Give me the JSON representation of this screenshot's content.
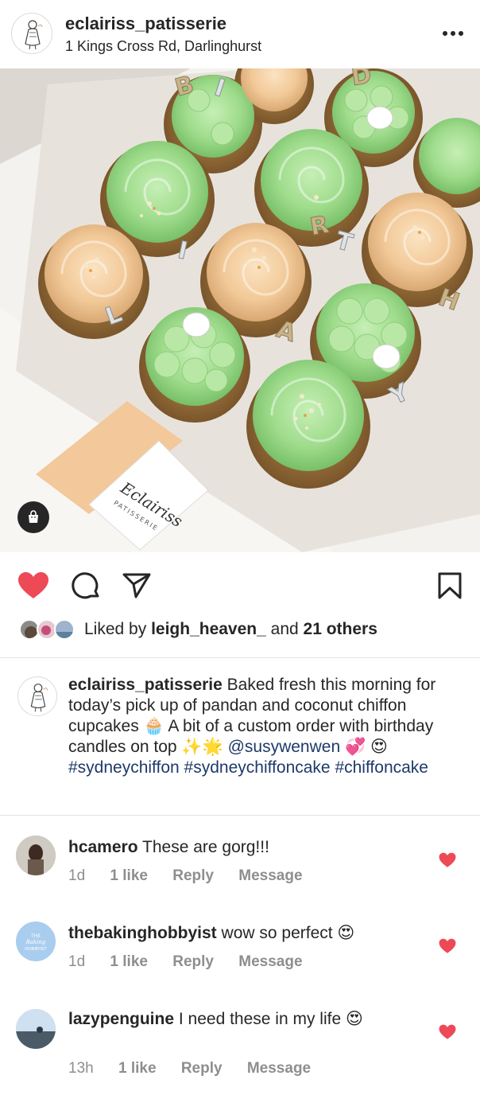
{
  "post": {
    "account": "eclairiss_patisserie",
    "location": "1 Kings Cross Rd, Darlinghurst",
    "liked_by_prefix": "Liked by",
    "liked_by_user": "leigh_heaven_",
    "liked_by_and": "and",
    "liked_by_others": "21 others",
    "is_liked": true
  },
  "photo": {
    "card_brand": "Eclairiss",
    "card_sub": "PATISSERIE",
    "candle_letters": [
      "B",
      "I",
      "R",
      "T",
      "H",
      "D",
      "A",
      "Y"
    ]
  },
  "caption": {
    "user": "eclairiss_patisserie",
    "text": "Baked fresh this morning for today’s pick up of pandan and coconut chiffon cupcakes 🧁 A bit of a custom order with birthday candles on top ✨🌟",
    "mention": "@susywenwen",
    "emoji_after_mention": "💞 😍",
    "hashtags": "#sydneychiffon #sydneychiffoncake #chiffoncake"
  },
  "comments": [
    {
      "user": "hcamero",
      "text": "These are gorg!!!",
      "time": "1d",
      "likes": "1 like",
      "reply": "Reply",
      "message": "Message"
    },
    {
      "user": "thebakinghobbyist",
      "text": "wow so perfect 😍",
      "time": "1d",
      "likes": "1 like",
      "reply": "Reply",
      "message": "Message",
      "avatar_text": "THE Baking HOBBYIST"
    },
    {
      "user": "lazypenguine",
      "text": "I need these in my life 😍",
      "time": "13h",
      "likes": "1 like",
      "reply": "Reply",
      "message": "Message"
    }
  ],
  "colors": {
    "like_red": "#ed4956",
    "text": "#262626",
    "muted": "#8e8e8e",
    "hashtag": "#1e3a69",
    "frosting_green": "#9fdc8c",
    "frosting_peach": "#f2c998"
  },
  "icons": [
    "more-icon",
    "shopping-bag-icon",
    "heart-icon",
    "comment-icon",
    "share-icon",
    "bookmark-icon"
  ]
}
